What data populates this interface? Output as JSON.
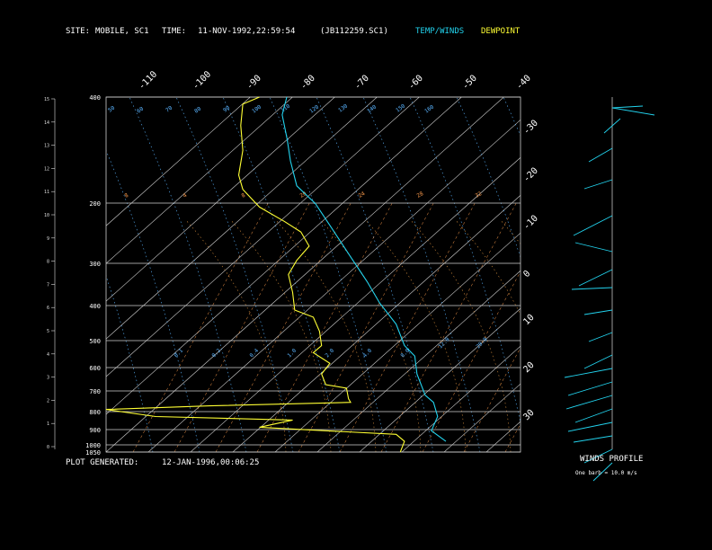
{
  "header": {
    "site_label": "SITE:",
    "site_value": "MOBILE, SC1",
    "time_label": "TIME:",
    "time_value": "11-NOV-1992,22:59:54",
    "file_id": "(JB112259.SC1)",
    "legend_temp": "TEMP/WINDS",
    "legend_dew": "DEWPOINT"
  },
  "footer": {
    "plot_label": "PLOT GENERATED:",
    "plot_value": "12-JAN-1996,00:06:25"
  },
  "winds_panel": {
    "title": "WINDS PROFILE",
    "note": "One barb = 10.0 m/s"
  },
  "colors": {
    "temp": "#22d3ee",
    "dewpoint": "#ffff33",
    "isobar": "#cfcfcf",
    "isotherm": "#cfcfcf",
    "mixing_ratio": "#ff9d4d",
    "dry_adiabat": "#5ab4ff",
    "moist_adiabat": "#d08a3a"
  },
  "chart_data": {
    "type": "line",
    "pressure_ticks": [
      "400",
      "200",
      "300",
      "400",
      "500",
      "600",
      "700",
      "800",
      "900",
      "1000",
      "1050"
    ],
    "temperature_ticks": [
      "-110",
      "-100",
      "-90",
      "-80",
      "-70",
      "-60",
      "-50",
      "-40"
    ],
    "right_ticks": [
      "-30",
      "-20",
      "-10",
      "0",
      "10",
      "20",
      "30"
    ],
    "height_ticks": [
      "0",
      "1",
      "2",
      "3",
      "4",
      "5",
      "6",
      "7",
      "8",
      "9",
      "10",
      "11",
      "12",
      "13",
      "14",
      "15"
    ],
    "mixing_ratio_labels": [
      "8",
      "4",
      "8",
      "20",
      "24",
      "28",
      "32"
    ],
    "low_mixing_labels": [
      "0.1",
      "0.2",
      "0.4",
      "1.0",
      "2.0",
      "4.0",
      "8.0",
      "12.0",
      "20.0"
    ],
    "adiabat_labels": [
      "50",
      "60",
      "70",
      "80",
      "90",
      "100",
      "110",
      "120",
      "130",
      "140",
      "150",
      "160"
    ],
    "series": [
      {
        "name": "TEMP/WINDS",
        "points": [
          [
            0.436,
            0.0
          ],
          [
            0.425,
            0.05
          ],
          [
            0.437,
            0.12
          ],
          [
            0.445,
            0.18
          ],
          [
            0.46,
            0.25
          ],
          [
            0.505,
            0.3
          ],
          [
            0.545,
            0.37
          ],
          [
            0.59,
            0.45
          ],
          [
            0.63,
            0.52
          ],
          [
            0.66,
            0.58
          ],
          [
            0.7,
            0.64
          ],
          [
            0.72,
            0.7
          ],
          [
            0.745,
            0.73
          ],
          [
            0.75,
            0.78
          ],
          [
            0.77,
            0.84
          ],
          [
            0.79,
            0.86
          ],
          [
            0.8,
            0.9
          ],
          [
            0.785,
            0.94
          ],
          [
            0.82,
            0.97
          ]
        ]
      },
      {
        "name": "DEWPOINT",
        "points": [
          [
            0.37,
            0.0
          ],
          [
            0.33,
            0.02
          ],
          [
            0.325,
            0.08
          ],
          [
            0.33,
            0.15
          ],
          [
            0.32,
            0.22
          ],
          [
            0.33,
            0.26
          ],
          [
            0.37,
            0.31
          ],
          [
            0.43,
            0.35
          ],
          [
            0.47,
            0.38
          ],
          [
            0.49,
            0.42
          ],
          [
            0.46,
            0.46
          ],
          [
            0.44,
            0.5
          ],
          [
            0.45,
            0.55
          ],
          [
            0.455,
            0.6
          ],
          [
            0.5,
            0.62
          ],
          [
            0.515,
            0.66
          ],
          [
            0.52,
            0.7
          ],
          [
            0.5,
            0.72
          ],
          [
            0.54,
            0.75
          ],
          [
            0.52,
            0.78
          ],
          [
            0.53,
            0.81
          ],
          [
            0.58,
            0.82
          ],
          [
            0.585,
            0.85
          ],
          [
            0.59,
            0.86
          ],
          [
            0.25,
            0.87
          ],
          [
            0.0,
            0.88
          ],
          [
            0.12,
            0.9
          ],
          [
            0.45,
            0.91
          ],
          [
            0.37,
            0.93
          ],
          [
            0.53,
            0.94
          ],
          [
            0.7,
            0.95
          ],
          [
            0.72,
            0.97
          ],
          [
            0.71,
            1.0
          ]
        ]
      }
    ]
  }
}
